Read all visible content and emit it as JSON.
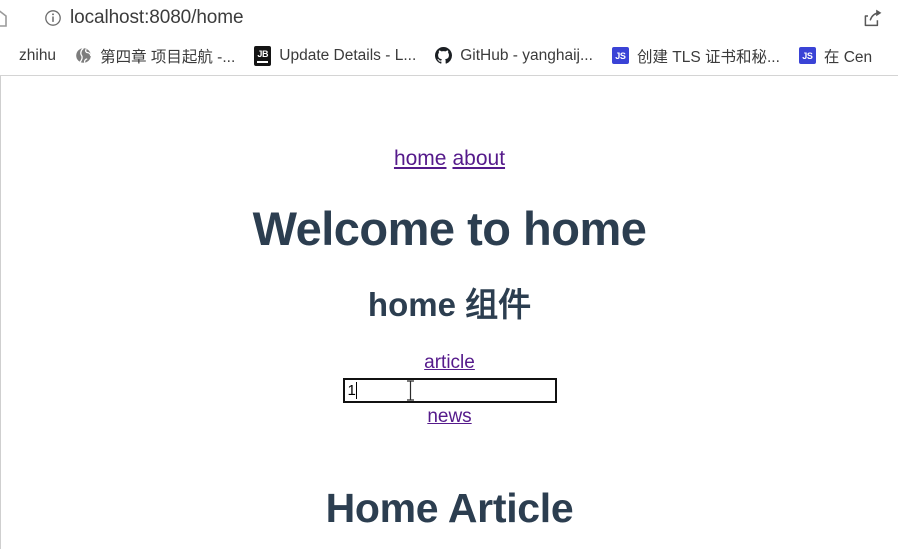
{
  "browser": {
    "back_icon": "back-arrow-icon",
    "info_icon": "info-circle-icon",
    "url": "localhost:8080/home",
    "share_icon": "share-icon",
    "bookmarks": [
      {
        "label": "zhihu",
        "icon": "none"
      },
      {
        "label": "第四章 项目起航 -...",
        "icon": "globe-icon"
      },
      {
        "label": "Update Details - L...",
        "icon": "jetbrains-icon",
        "icon_text": "JB"
      },
      {
        "label": "GitHub - yanghaij...",
        "icon": "github-icon"
      },
      {
        "label": "创建 TLS 证书和秘...",
        "icon": "js-icon",
        "icon_text": "JS"
      },
      {
        "label": "在 Cen",
        "icon": "js-icon",
        "icon_text": "JS"
      }
    ]
  },
  "page": {
    "nav": {
      "home_label": "home",
      "about_label": "about"
    },
    "heading_welcome": "Welcome to home",
    "heading_component": "home 组件",
    "sub_links": {
      "article_label": "article",
      "news_label": "news"
    },
    "input": {
      "value": "1",
      "placeholder": ""
    },
    "heading_article": "Home Article"
  },
  "colors": {
    "heading": "#2c3e50",
    "link_visited": "#551a8b",
    "js_favicon": "#3a43d6",
    "jb_favicon": "#141414",
    "chrome_separator": "#d4d4d4"
  }
}
